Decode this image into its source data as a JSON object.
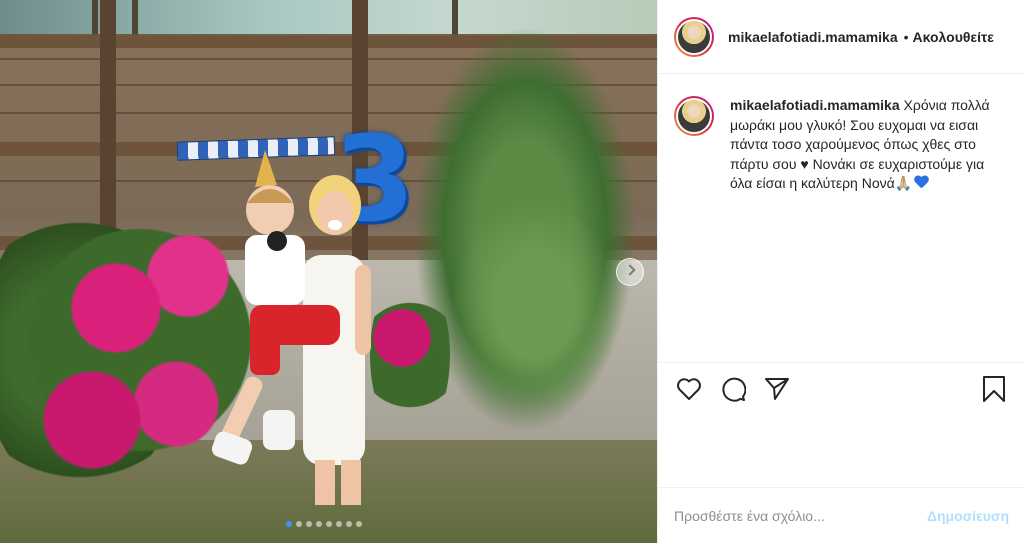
{
  "post": {
    "username": "mikaelafotiadi.mamamika",
    "follow_separator": "•",
    "follow_label": "Ακολουθείτε",
    "caption_username": "mikaelafotiadi.mamamika",
    "caption_text": "Χρόνια πολλά μωράκι μου γλυκό! Σου ευχομαι να εισαι πάντα τοσο χαρούμενος όπως χθες στο πάρτυ σου ♥ Νονάκι σε ευχαριστούμε για όλα είσαι η καλύτερη Νονά",
    "caption_emoji_1": "🙏🏼",
    "caption_emoji_2": "blue-heart",
    "balloon_number": "3"
  },
  "carousel": {
    "total_slides": 8,
    "active_slide": 1
  },
  "actions": {
    "like": "heart-icon",
    "comment": "comment-icon",
    "share": "paper-plane-icon",
    "save": "bookmark-icon"
  },
  "comment": {
    "placeholder": "Προσθέστε ένα σχόλιο...",
    "post_label": "Δημοσίευση"
  },
  "colors": {
    "accent": "#3897f0",
    "post_button_disabled": "#b2dffc",
    "text": "#262626",
    "muted": "#8e8e8e",
    "divider": "#efefef"
  }
}
